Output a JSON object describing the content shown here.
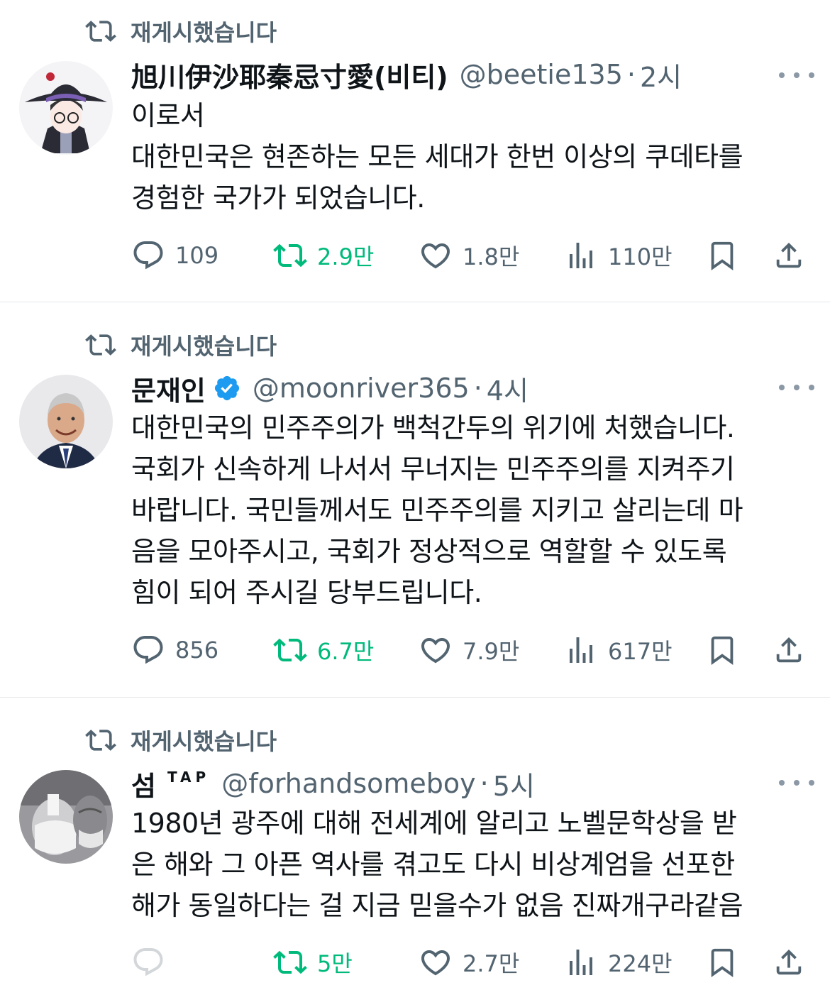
{
  "tweets": [
    {
      "repost_label": "재게시했습니다",
      "name": "旭川伊沙耶秦忌寸愛(비티)",
      "handle": "@beetie135",
      "time": "2시",
      "body": "이로서\n대한민국은 현존하는 모든 세대가 한번 이상의 쿠데타를\n경험한 국가가 되었습니다.",
      "replies": "109",
      "reposts": "2.9만",
      "likes": "1.8만",
      "views": "110만"
    },
    {
      "repost_label": "재게시했습니다",
      "name": "문재인",
      "handle": "@moonriver365",
      "time": "4시",
      "body": "대한민국의 민주주의가 백척간두의 위기에 처했습니다.\n국회가 신속하게 나서서 무너지는 민주주의를 지켜주기\n바랍니다. 국민들께서도 민주주의를 지키고 살리는데 마\n음을 모아주시고, 국회가 정상적으로 역할할 수 있도록\n힘이 되어 주시길 당부드립니다.",
      "replies": "856",
      "reposts": "6.7만",
      "likes": "7.9만",
      "views": "617만"
    },
    {
      "repost_label": "재게시했습니다",
      "name": "섬",
      "name_badge": "TAP",
      "handle": "@forhandsomeboy",
      "time": "5시",
      "body": "1980년 광주에 대해 전세계에 알리고 노벨문학상을 받\n은 해와 그 아픈 역사를 겪고도 다시 비상계엄을 선포한\n해가 동일하다는 걸 지금 믿을수가 없음 진짜개구라같음",
      "replies": "",
      "reposts": "5만",
      "likes": "2.7만",
      "views": "224만"
    }
  ],
  "colors": {
    "text": "#0f1419",
    "muted": "#536471",
    "repost_green": "#00ba7c",
    "verified_blue": "#1d9bf0",
    "divider": "#e3e7ea"
  },
  "icons": {
    "repost": "repost-icon",
    "reply": "reply-icon",
    "like": "heart-icon",
    "views": "views-icon",
    "bookmark": "bookmark-icon",
    "share": "share-icon",
    "more": "more-icon",
    "verified": "verified-badge-icon"
  },
  "dot_separator": "·"
}
